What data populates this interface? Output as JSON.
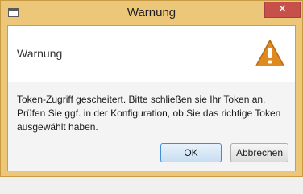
{
  "window": {
    "title": "Warnung",
    "close_glyph": "✕"
  },
  "dialog": {
    "header": "Warnung",
    "icon": "warning-triangle-icon",
    "message": "Token-Zugriff gescheitert. Bitte schließen sie Ihr Token an.\nPrüfen Sie ggf. in der Konfiguration, ob Sie das richtige Token\nausgewählt haben.",
    "buttons": {
      "ok": "OK",
      "cancel": "Abbrechen"
    }
  },
  "colors": {
    "title_bar": "#ecc679",
    "close_button": "#c7504a",
    "warning_icon": "#e08a1e",
    "ok_border": "#3c8fd6"
  }
}
